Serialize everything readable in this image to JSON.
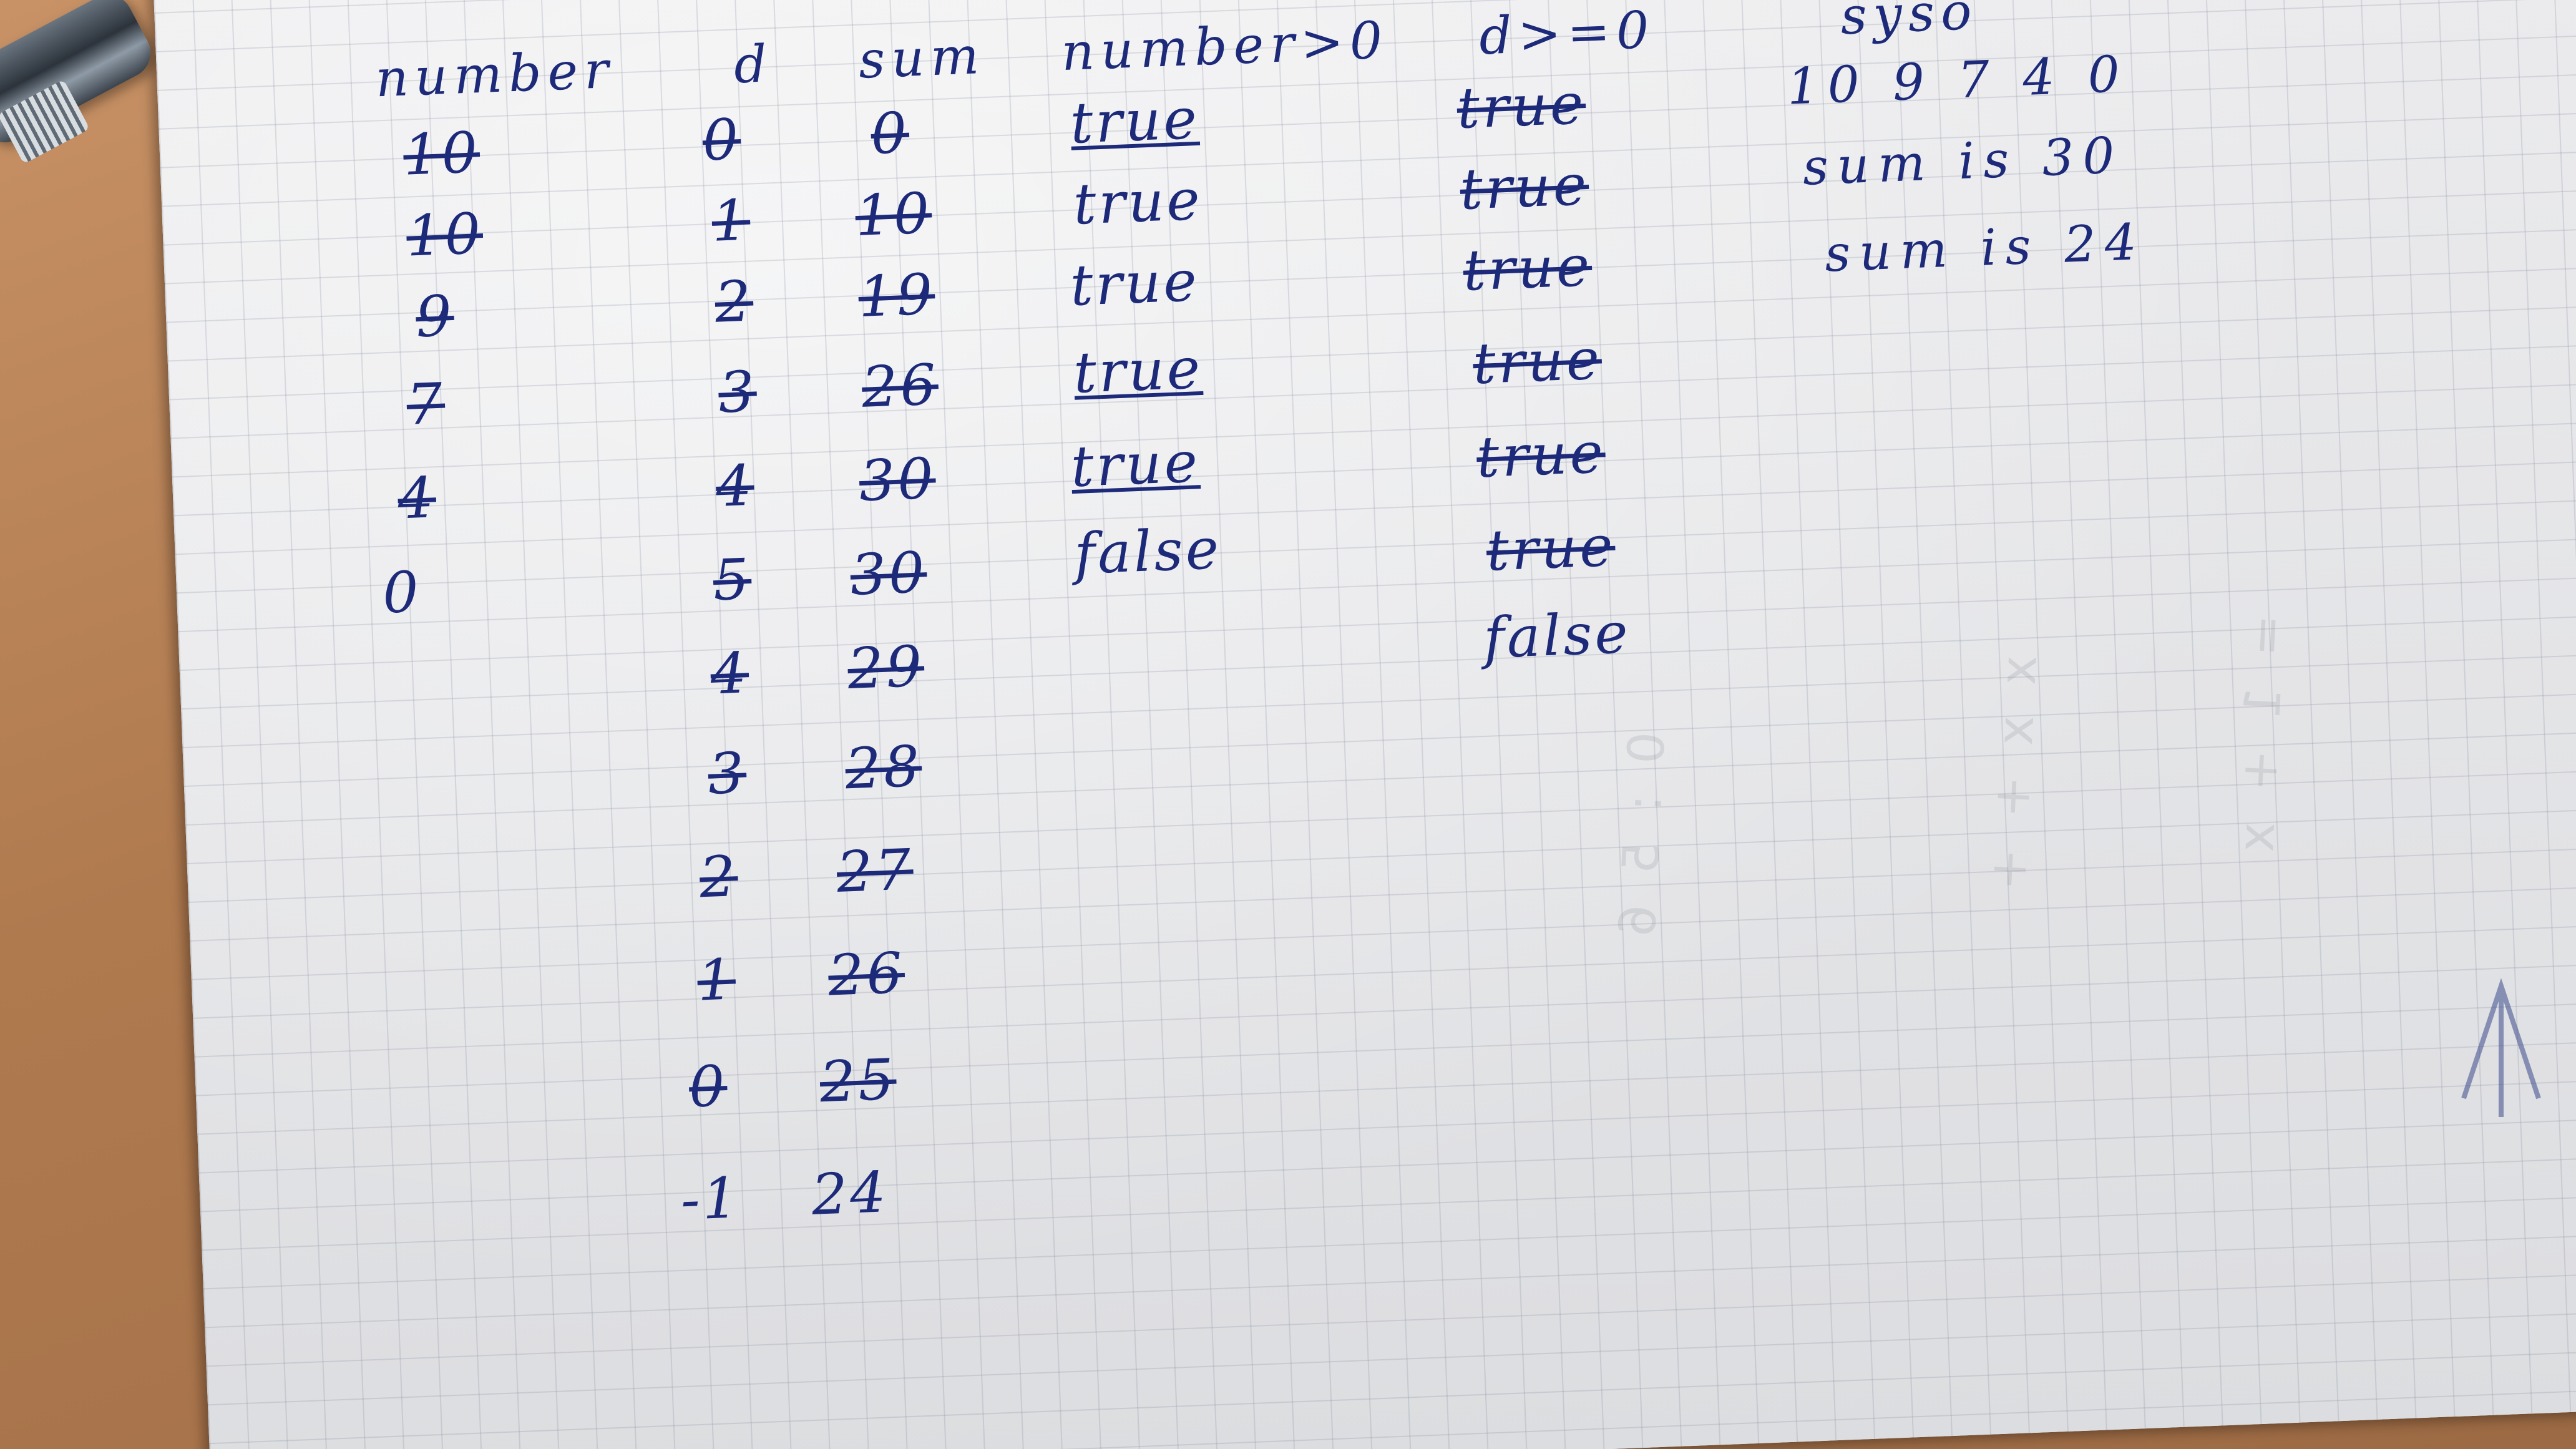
{
  "headers": {
    "number": "number",
    "d": "d",
    "sum": "sum",
    "condition1": "number>0",
    "condition2": "d>=0",
    "output": "syso"
  },
  "columns": {
    "number": [
      {
        "text": "10",
        "struck": true
      },
      {
        "text": "10",
        "struck": true
      },
      {
        "text": "9",
        "struck": true
      },
      {
        "text": "7",
        "struck": true
      },
      {
        "text": "4",
        "struck": true
      },
      {
        "text": "0",
        "struck": false
      }
    ],
    "d": [
      {
        "text": "0",
        "struck": true
      },
      {
        "text": "1",
        "struck": true
      },
      {
        "text": "2",
        "struck": true
      },
      {
        "text": "3",
        "struck": true
      },
      {
        "text": "4",
        "struck": true
      },
      {
        "text": "5",
        "struck": true
      },
      {
        "text": "4",
        "struck": true
      },
      {
        "text": "3",
        "struck": true
      },
      {
        "text": "2",
        "struck": true
      },
      {
        "text": "1",
        "struck": true
      },
      {
        "text": "0",
        "struck": true
      },
      {
        "text": "-1",
        "struck": false
      }
    ],
    "sum": [
      {
        "text": "0",
        "struck": true
      },
      {
        "text": "10",
        "struck": true
      },
      {
        "text": "19",
        "struck": true
      },
      {
        "text": "26",
        "struck": true
      },
      {
        "text": "30",
        "struck": true
      },
      {
        "text": "30",
        "struck": true
      },
      {
        "text": "29",
        "struck": true
      },
      {
        "text": "28",
        "struck": true
      },
      {
        "text": "27",
        "struck": true
      },
      {
        "text": "26",
        "struck": true
      },
      {
        "text": "25",
        "struck": true
      },
      {
        "text": "24",
        "struck": false
      }
    ],
    "condition1": [
      {
        "text": "true",
        "underlined": true
      },
      {
        "text": "true",
        "underlined": false
      },
      {
        "text": "true",
        "underlined": false
      },
      {
        "text": "true",
        "underlined": true
      },
      {
        "text": "true",
        "underlined": true
      },
      {
        "text": "false",
        "underlined": false
      }
    ],
    "condition2": [
      {
        "text": "true",
        "struck": true
      },
      {
        "text": "true",
        "struck": true
      },
      {
        "text": "true",
        "struck": true
      },
      {
        "text": "true",
        "struck": true
      },
      {
        "text": "true",
        "struck": true
      },
      {
        "text": "true",
        "struck": true
      },
      {
        "text": "false",
        "struck": false
      }
    ],
    "output": [
      {
        "text": "10 9 7 4 0"
      },
      {
        "text": "sum is 30"
      },
      {
        "text": "sum is 24"
      }
    ]
  },
  "colors": {
    "ink": "#1d2a7a",
    "paper": "#e9e9ea",
    "grid": "#7882968a"
  }
}
